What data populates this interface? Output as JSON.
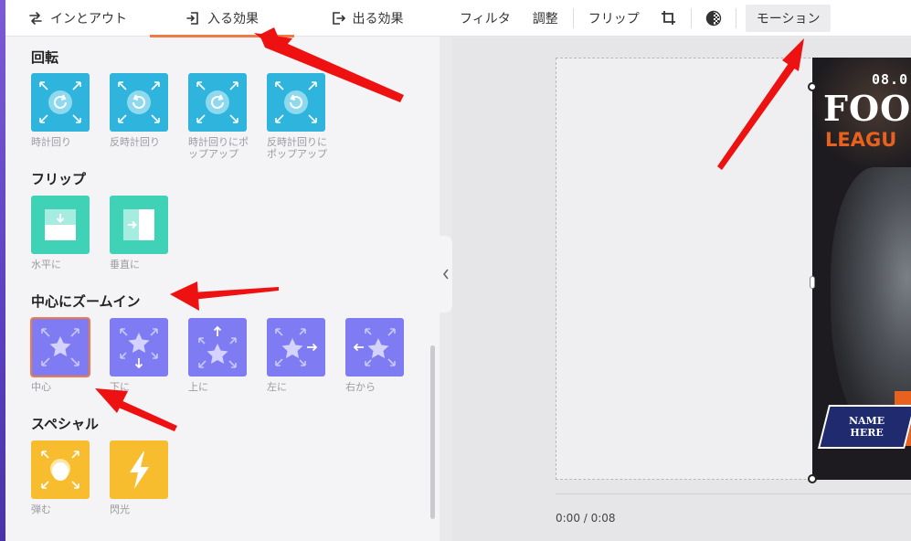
{
  "tabs": [
    {
      "label": "インとアウト",
      "icon": "swap-icon"
    },
    {
      "label": "入る効果",
      "icon": "enter-icon",
      "active": true
    },
    {
      "label": "出る効果",
      "icon": "exit-icon"
    }
  ],
  "sections": {
    "rotate": {
      "title": "回転",
      "items": [
        {
          "label": "時計回り"
        },
        {
          "label": "反時計回り"
        },
        {
          "label": "時計回りにポップアップ",
          "line1": "時計回りにポ",
          "line2": "ップアップ"
        },
        {
          "label": "反時計回りにポップアップ",
          "line1": "反時計回りに",
          "line2": "ポップアップ"
        }
      ]
    },
    "flip": {
      "title": "フリップ",
      "items": [
        {
          "label": "水平に"
        },
        {
          "label": "垂直に"
        }
      ]
    },
    "zoom": {
      "title": "中心にズームイン",
      "items": [
        {
          "label": "中心",
          "selected": true
        },
        {
          "label": "下に"
        },
        {
          "label": "上に"
        },
        {
          "label": "左に"
        },
        {
          "label": "右から"
        }
      ]
    },
    "special": {
      "title": "スペシャル",
      "items": [
        {
          "label": "弾む"
        },
        {
          "label": "閃光"
        }
      ]
    }
  },
  "toolbar": {
    "filter": "フィルタ",
    "adjust": "調整",
    "flip": "フリップ",
    "motion": "モーション"
  },
  "poster": {
    "date": "08.0",
    "title": "FOOT",
    "subtitle": "LEAGU",
    "name_line1": "NAME",
    "name_line2": "HERE"
  },
  "time": "0:00 / 0:08",
  "colors": {
    "accent": "#f07a45",
    "rotate_tile": "#2fb5dd",
    "flip_tile": "#3fd2b6",
    "zoom_tile": "#7f7cf3",
    "special_tile": "#f7bd2e",
    "annotation_arrow": "#ee1111"
  }
}
